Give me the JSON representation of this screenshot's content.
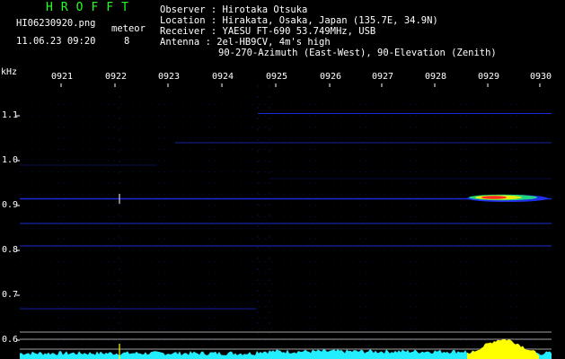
{
  "header": {
    "brand": "HROFFT",
    "filename": "HI06230920.png",
    "timestamp": "11.06.23 09:20",
    "meteor_label": "meteor",
    "meteor_count": "8"
  },
  "info": {
    "observer": "Observer : Hirotaka Otsuka",
    "location": "Location : Hirakata, Osaka, Japan (135.7E, 34.9N)",
    "receiver": "Receiver : YAESU FT-690 53.749MHz, USB",
    "antenna": "Antenna  : 2el-HB9CV, 4m's high",
    "antenna2": "90-270-Azimuth (East-West), 90-Elevation (Zenith)"
  },
  "chart_data": {
    "type": "heatmap",
    "y_unit": "kHz",
    "x_ticks": [
      "0921",
      "0922",
      "0923",
      "0924",
      "0925",
      "0926",
      "0927",
      "0928",
      "0929",
      "0930"
    ],
    "y_ticks": [
      "1.1",
      "1.0",
      "0.9",
      "0.8",
      "0.7",
      "0.6"
    ],
    "ylim": [
      0.58,
      1.15
    ],
    "colors": {
      "background": "#000000",
      "trace": "#2233ff",
      "meteor_hot": "#ff2222",
      "meteor_warm": "#ffee00",
      "meteor_cool": "#22ff66",
      "spectrum_fill": "#22eeff",
      "spectrum_peak": "#ffff00",
      "grid": "#ffffff"
    },
    "carrier_khz": 0.915,
    "meteor": {
      "time_start": "0928.8",
      "time_end": "0929.9",
      "freq_khz": 0.916
    },
    "horizontal_lines_khz": [
      1.105,
      1.04,
      0.915,
      0.86,
      0.81,
      0.67
    ]
  }
}
